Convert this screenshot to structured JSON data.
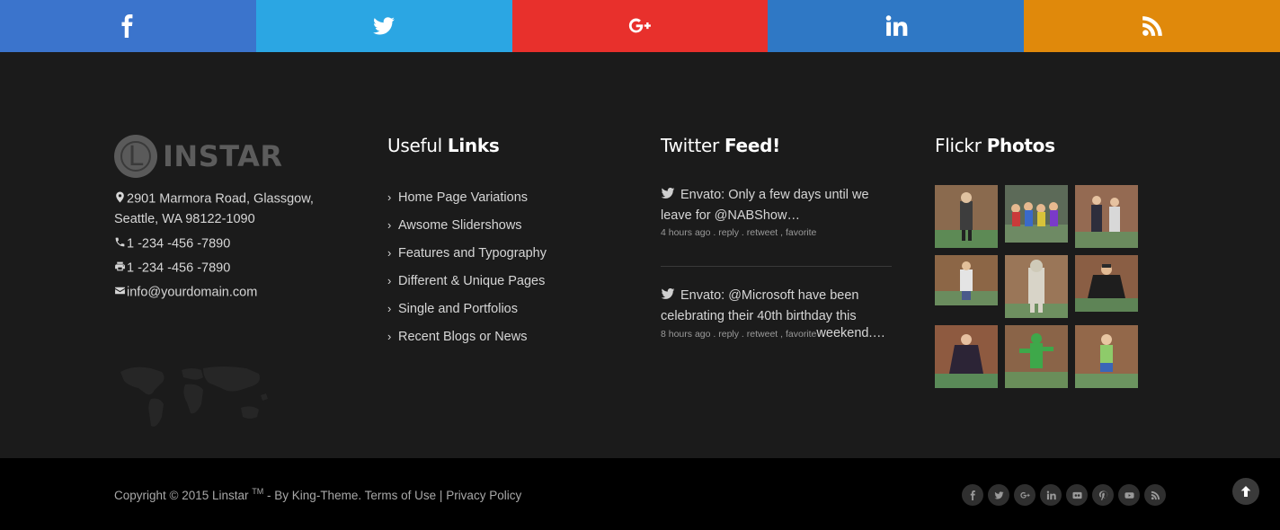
{
  "social_bar": [
    {
      "name": "facebook",
      "icon": "facebook-icon",
      "color": "#3b74cc"
    },
    {
      "name": "twitter",
      "icon": "twitter-icon",
      "color": "#2ba6e3"
    },
    {
      "name": "google-plus",
      "icon": "google-plus-icon",
      "color": "#e8302c"
    },
    {
      "name": "linkedin",
      "icon": "linkedin-icon",
      "color": "#2f78c5"
    },
    {
      "name": "rss",
      "icon": "rss-icon",
      "color": "#e0890b"
    }
  ],
  "brand": {
    "logo_letter": "L",
    "logo_text": "INSTAR",
    "address_line1": "2901 Marmora Road, Glassgow,",
    "address_line2": "Seattle, WA 98122-1090",
    "phone": "1 -234 -456 -7890",
    "fax": "1 -234 -456 -7890",
    "email": "info@yourdomain.com"
  },
  "useful_links": {
    "title_light": "Useful",
    "title_bold": "Links",
    "items": [
      "Home Page Variations",
      "Awsome Slidershows",
      "Features and Typography",
      "Different & Unique Pages",
      "Single and Portfolios",
      "Recent Blogs or News"
    ]
  },
  "twitter_feed": {
    "title_light": "Twitter",
    "title_bold": "Feed!",
    "tweets": [
      {
        "text": "Envato: Only a few days until we leave for @NABShow…",
        "time": "4 hours ago",
        "reply": "reply",
        "retweet": "retweet",
        "favorite": "favorite"
      },
      {
        "text_line1": "Envato: @Microsoft have been",
        "text_line2": "celebrating their 40th birthday this",
        "text_tail": "weekend.…",
        "time": "8 hours ago",
        "reply": "reply",
        "retweet": "retweet",
        "favorite": "favorite"
      }
    ]
  },
  "flickr": {
    "title_light": "Flickr",
    "title_bold": "Photos",
    "photos": 9
  },
  "footer_bottom": {
    "copyright_prefix": "Copyright © 2015 Linstar",
    "tm": "TM",
    "by": " - By King-Theme.",
    "terms": "Terms of Use",
    "separator": "|",
    "privacy": "Privacy Policy",
    "mini_social_icons": [
      "facebook-icon",
      "twitter-icon",
      "google-plus-icon",
      "linkedin-icon",
      "flickr-icon",
      "pinterest-icon",
      "youtube-icon",
      "rss-icon"
    ]
  }
}
